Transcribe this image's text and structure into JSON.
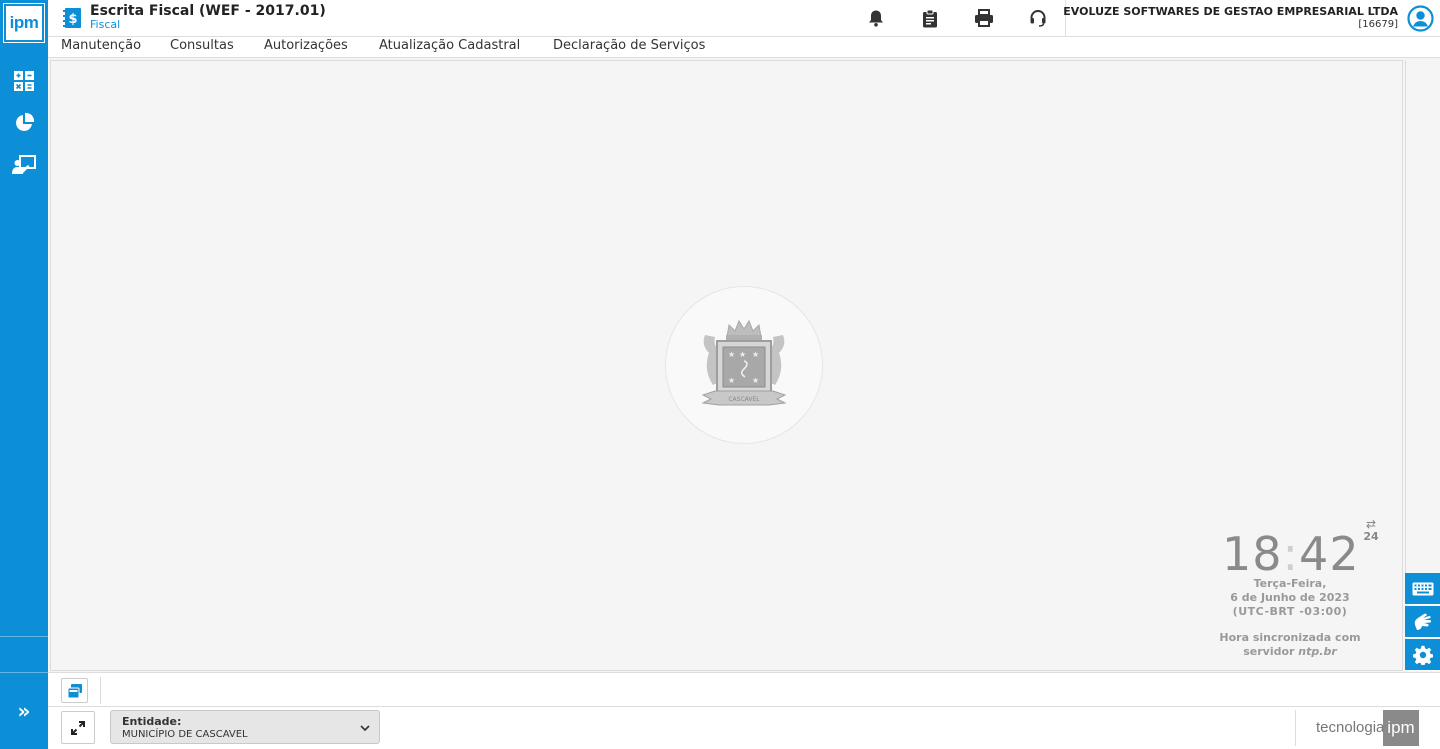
{
  "app": {
    "logo_text": "ipm",
    "title": "Escrita Fiscal (WEF - 2017.01)",
    "subtitle": "Fiscal"
  },
  "header": {
    "company_name": "EVOLUZE SOFTWARES DE GESTAO EMPRESARIAL LTDA",
    "company_code": "[16679]",
    "icons": [
      "bell-icon",
      "clipboard-icon",
      "printer-icon",
      "headset-icon",
      "user-circle-icon"
    ]
  },
  "sidebar": {
    "items": [
      {
        "icon": "calculator-icon"
      },
      {
        "icon": "pie-chart-icon"
      },
      {
        "icon": "presentation-icon"
      }
    ],
    "expand_icon": "double-chevron-right-icon"
  },
  "menu": {
    "items": [
      {
        "label": "Manutenção"
      },
      {
        "label": "Consultas"
      },
      {
        "label": "Autorizações"
      },
      {
        "label": "Atualização Cadastral"
      },
      {
        "label": "Declaração de Serviços"
      }
    ]
  },
  "clock": {
    "hours": "18",
    "minutes": "42",
    "format_toggle_arrow": "⇄",
    "format_toggle_label": "24",
    "day_of_week": "Terça-Feira,",
    "date": "6 de Junho de 2023",
    "timezone": "(UTC-BRT -03:00)",
    "sync_line1": "Hora sincronizada com",
    "sync_line2_prefix": "servidor ",
    "sync_line2_server": "ntp.br"
  },
  "emblem": {
    "banner_text": "CASCAVEL"
  },
  "right_tools": [
    "keyboard-icon",
    "sign-language-icon",
    "gear-icon"
  ],
  "footer": {
    "entity_label": "Entidade:",
    "entity_value": "MUNICÍPIO DE CASCAVEL",
    "brand_text": "tecnologia",
    "brand_logo": "ipm"
  },
  "colors": {
    "accent": "#0d8fd8",
    "clock_text": "#8a8a8a"
  }
}
